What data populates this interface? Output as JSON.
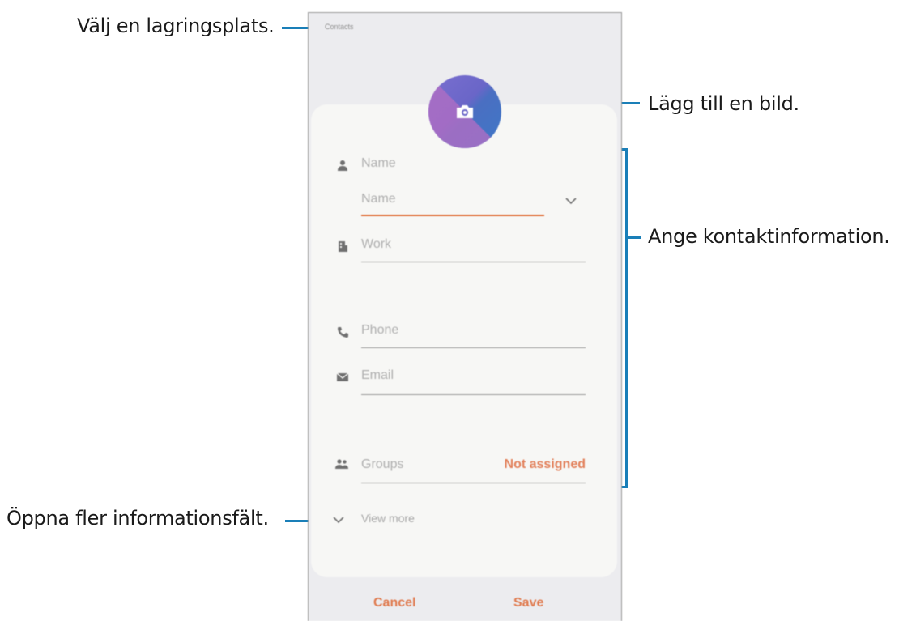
{
  "callouts": {
    "storage": "Välj en lagringsplats.",
    "picture": "Lägg till en bild.",
    "contact_info": "Ange kontaktinformation.",
    "more_fields": "Öppna fler informationsfält."
  },
  "screen": {
    "storage_label": "Contacts",
    "name_section_label": "Name",
    "name_field_placeholder": "Name",
    "work_placeholder": "Work",
    "phone_placeholder": "Phone",
    "email_placeholder": "Email",
    "groups_label": "Groups",
    "groups_value": "Not assigned",
    "view_more_label": "View more",
    "cancel_label": "Cancel",
    "save_label": "Save"
  },
  "colors": {
    "accent": "#e07a4e",
    "callout_line": "#1a7fb8",
    "avatar_gradient": [
      "#b06ec4",
      "#3f78c7"
    ]
  },
  "icons": [
    "person-icon",
    "building-icon",
    "phone-icon",
    "email-icon",
    "groups-icon",
    "camera-icon",
    "chevron-down-icon"
  ]
}
